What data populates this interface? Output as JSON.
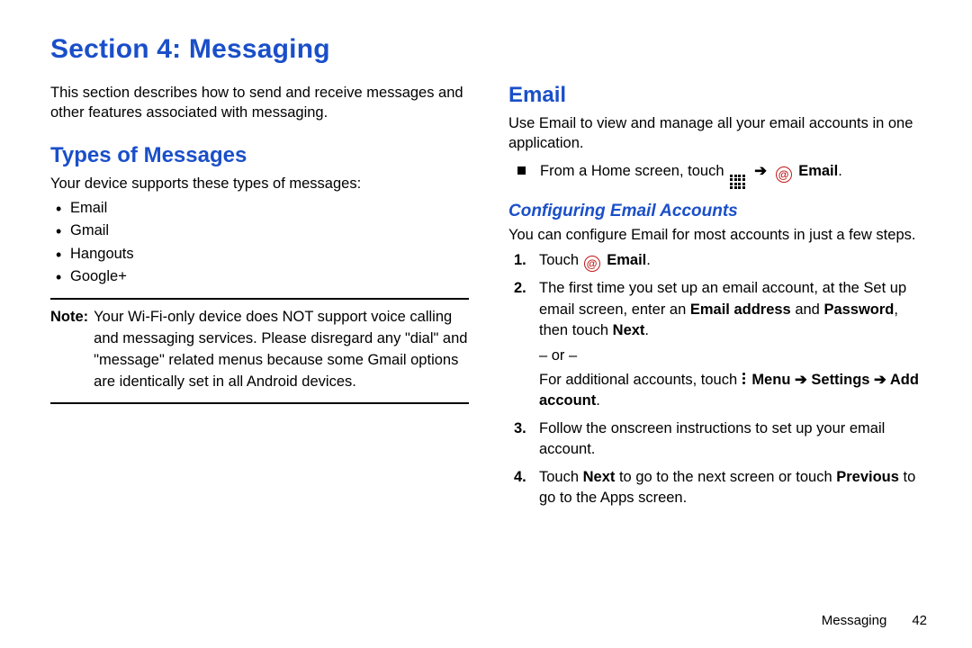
{
  "chart_data": null,
  "section_title": "Section 4: Messaging",
  "left": {
    "intro": "This section describes how to send and receive messages and other features associated with messaging.",
    "types_heading": "Types of Messages",
    "types_lead": "Your device supports these types of messages:",
    "types": [
      "Email",
      "Gmail",
      "Hangouts",
      "Google+"
    ],
    "note_label": "Note:",
    "note_text": "Your Wi-Fi-only device does NOT support voice calling and messaging services. Please disregard any \"dial\" and \"message\" related menus because some Gmail options are identically set in all Android devices."
  },
  "right": {
    "email_heading": "Email",
    "email_intro": "Use Email to view and manage all your email accounts in one application.",
    "from_home_prefix": "From a Home screen, touch",
    "arrow": "➔",
    "email_label": "Email",
    "config_heading": "Configuring Email Accounts",
    "config_lead": "You can configure Email for most accounts in just a few steps.",
    "steps": {
      "s1_pre": "Touch",
      "s1_post": "Email",
      "s2a": "The first time you set up an email account, at the Set up email screen, enter an ",
      "s2b": "Email address",
      "s2c": " and ",
      "s2d": "Password",
      "s2e": ", then touch ",
      "s2f": "Next",
      "s2or": "– or –",
      "s2g": "For additional accounts, touch ",
      "s2h": "Menu ➔ Settings ➔ Add account",
      "s3": "Follow the onscreen instructions to set up your email account.",
      "s4a": "Touch ",
      "s4b": "Next",
      "s4c": " to go to the next screen or touch ",
      "s4d": "Previous",
      "s4e": " to go to the Apps screen."
    },
    "nums": [
      "1.",
      "2.",
      "3.",
      "4."
    ]
  },
  "footer": {
    "section": "Messaging",
    "page": "42"
  }
}
